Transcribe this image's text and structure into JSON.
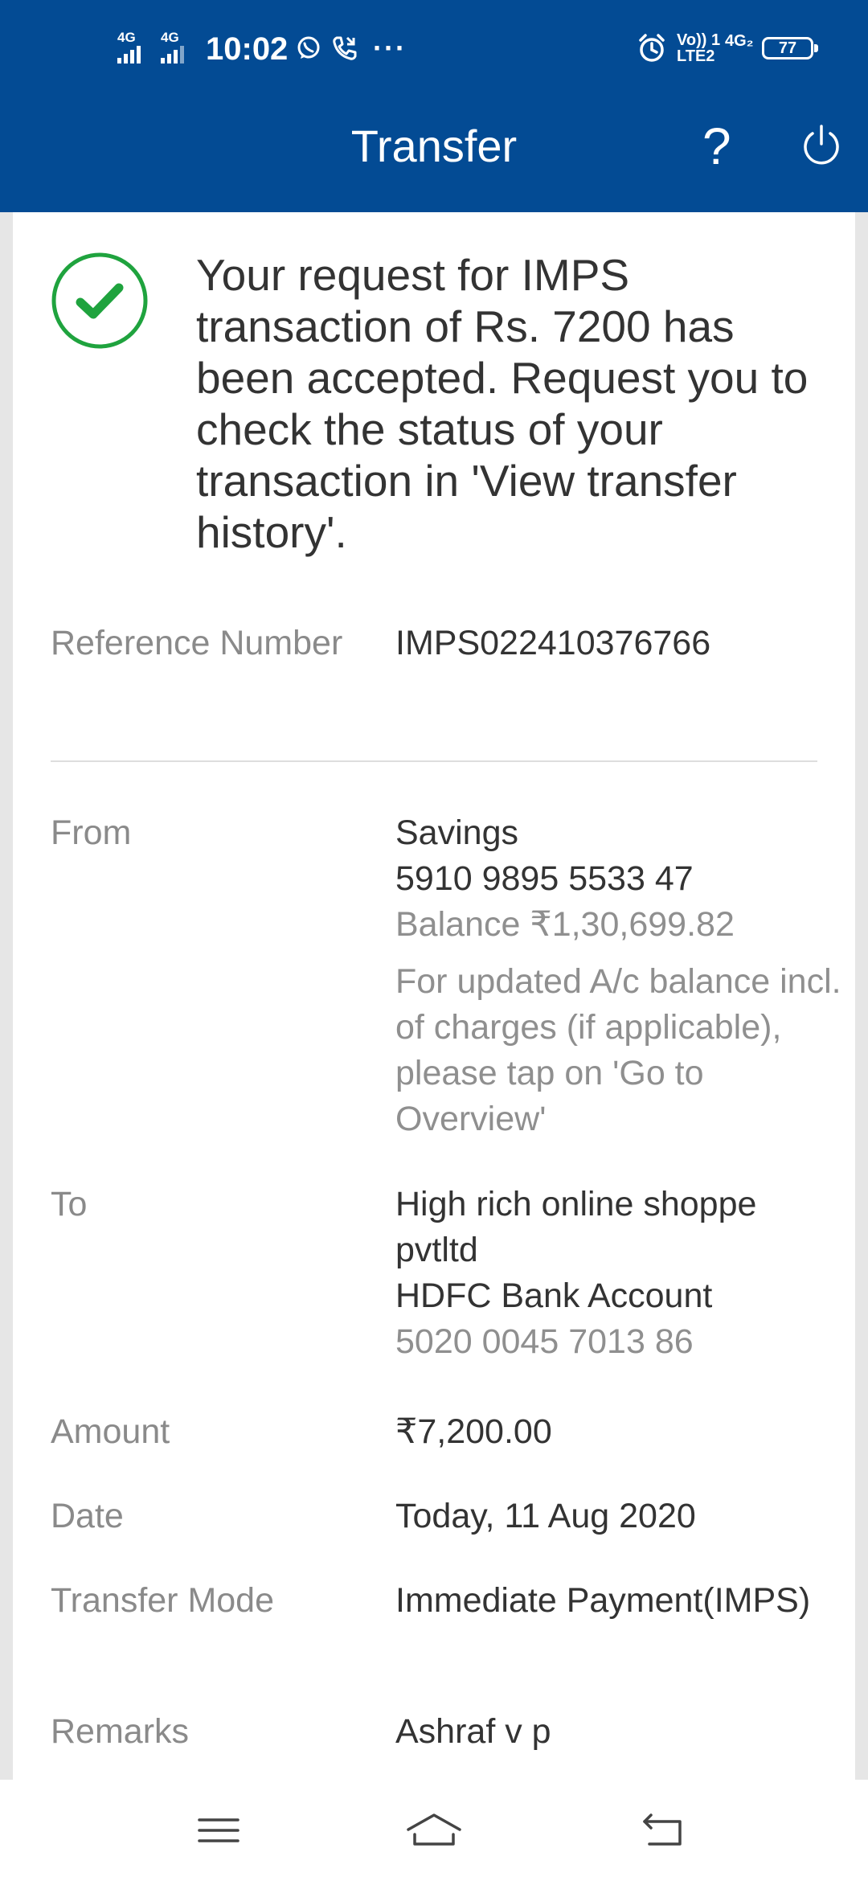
{
  "status_bar": {
    "network_1": "4G",
    "network_2": "4G",
    "time": "10:02",
    "more": "···",
    "volte": "Vo)) 1",
    "lte": "LTE2",
    "network_3": "4G₂",
    "battery": "77",
    "icons": [
      "whatsapp-icon",
      "phone-call-icon",
      "alarm-icon"
    ]
  },
  "app_bar": {
    "title": "Transfer",
    "help": "?",
    "icons": [
      "help-icon",
      "power-icon"
    ]
  },
  "confirmation": {
    "icon": "check-circle-icon",
    "message": "Your request for IMPS transaction of Rs. 7200 has been accepted. Request you to check the status of your transaction in 'View transfer history'."
  },
  "details": {
    "reference": {
      "label": "Reference Number",
      "value": "IMPS022410376766"
    },
    "from": {
      "label": "From",
      "account_type": "Savings",
      "account_number": "5910 9895 5533 47",
      "balance": "Balance ₹1,30,699.82",
      "note": "For updated A/c balance incl. of charges (if applicable), please tap on 'Go to Overview'"
    },
    "to": {
      "label": "To",
      "name": "High rich online shoppe pvtltd",
      "bank": "HDFC Bank Account",
      "account_number": "5020 0045 7013 86"
    },
    "amount": {
      "label": "Amount",
      "value": "₹7,200.00"
    },
    "date": {
      "label": "Date",
      "value": "Today, 11 Aug 2020"
    },
    "mode": {
      "label": "Transfer Mode",
      "value": "Immediate Payment(IMPS)"
    },
    "remarks": {
      "label": "Remarks",
      "value": "Ashraf v p"
    }
  },
  "nav_bar": {
    "icons": [
      "menu-icon",
      "home-icon",
      "back-icon"
    ]
  },
  "colors": {
    "header": "#034b94",
    "success": "#1fa33e",
    "label": "#8a8a8a",
    "text": "#333333"
  }
}
